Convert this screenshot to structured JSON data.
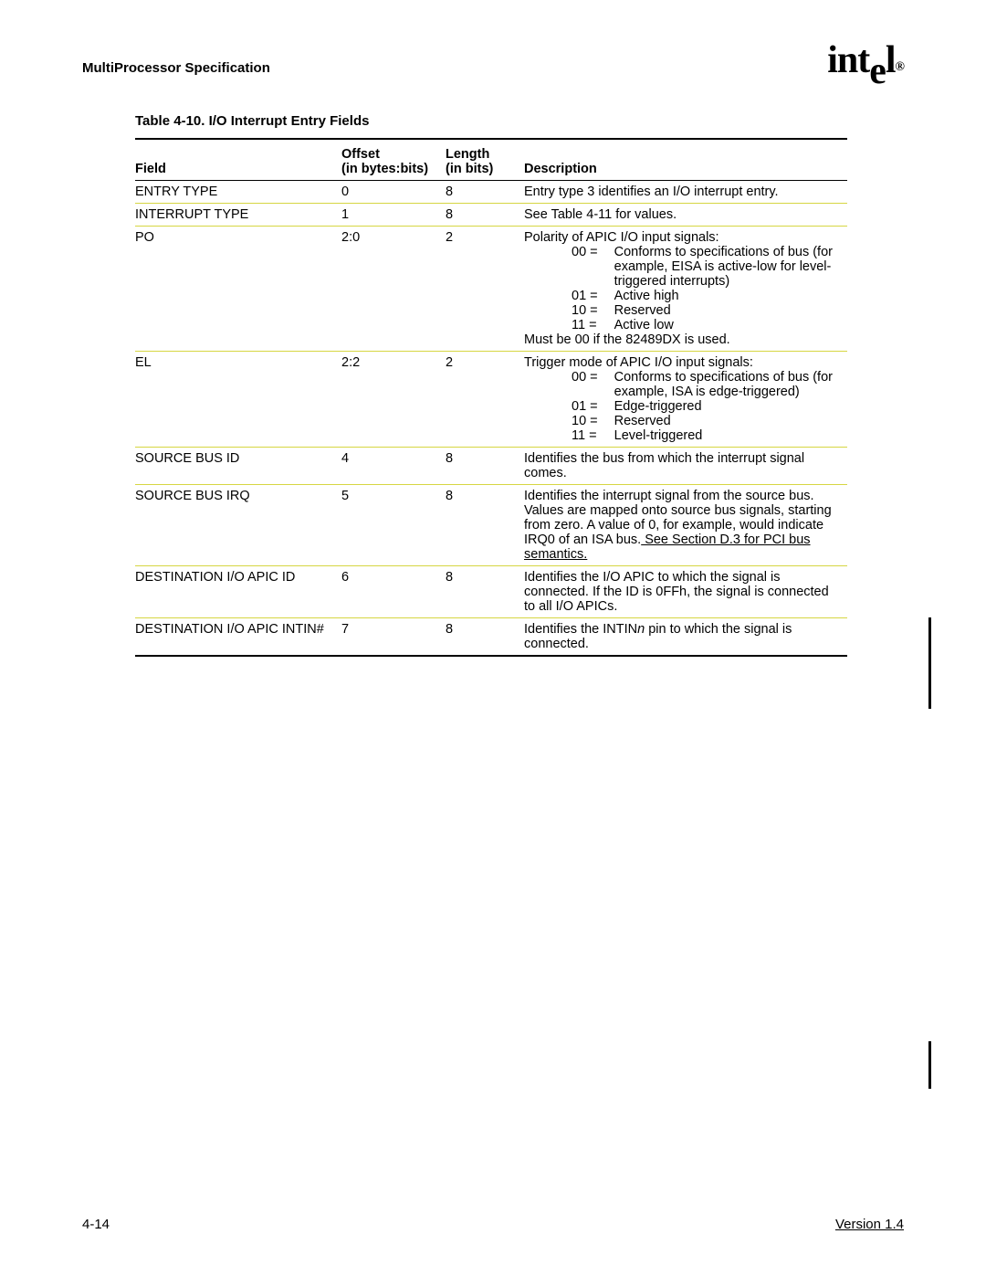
{
  "header": {
    "spec_title": "MultiProcessor Specification",
    "logo_text": "intel"
  },
  "caption": "Table 4-10.  I/O Interrupt Entry Fields",
  "columns": {
    "field": "Field",
    "offset_l1": "Offset",
    "offset_l2": "(in bytes:bits)",
    "length_l1": "Length",
    "length_l2": "(in bits)",
    "desc": "Description"
  },
  "rows": [
    {
      "field": "ENTRY TYPE",
      "offset": "0",
      "length": "8",
      "desc_pre": "Entry type 3 identifies an I/O interrupt entry."
    },
    {
      "field": "INTERRUPT TYPE",
      "offset": "1",
      "length": "8",
      "desc_pre": "See Table 4-11 for values."
    },
    {
      "field": "PO",
      "offset": "2:0",
      "length": "2",
      "desc_pre": "Polarity of APIC I/O input signals:",
      "sub": [
        {
          "k": "00 =",
          "v": "Conforms to specifications of bus (for example, EISA is active-low for level-triggered interrupts)"
        },
        {
          "k": "01 =",
          "v": "Active high"
        },
        {
          "k": "10 =",
          "v": "Reserved"
        },
        {
          "k": "11 =",
          "v": "Active low"
        }
      ],
      "desc_post": "Must be 00 if the 82489DX is used."
    },
    {
      "field": "EL",
      "offset": "2:2",
      "length": "2",
      "desc_pre": "Trigger mode of APIC I/O input signals:",
      "sub": [
        {
          "k": "00 =",
          "v": "Conforms to specifications of bus (for example, ISA is edge-triggered)"
        },
        {
          "k": "01 =",
          "v": "Edge-triggered"
        },
        {
          "k": "10 =",
          "v": "Reserved"
        },
        {
          "k": "11 =",
          "v": "Level-triggered"
        }
      ]
    },
    {
      "field": "SOURCE BUS ID",
      "offset": "4",
      "length": "8",
      "desc_pre": "Identifies the bus from which the interrupt signal comes."
    },
    {
      "field": "SOURCE BUS IRQ",
      "offset": "5",
      "length": "8",
      "desc_pre": "Identifies the interrupt signal from the source bus.  Values are mapped onto source bus signals, starting from zero.  A value of 0, for example, would indicate IRQ0 of an ISA bus.",
      "link_text": "  See Section D.3 for PCI bus semantics."
    },
    {
      "field": "DESTINATION I/O APIC ID",
      "offset": "6",
      "length": "8",
      "desc_pre": "Identifies the I/O APIC to which the signal is connected.  If the ID is 0FFh, the signal is connected to all I/O APICs."
    },
    {
      "field": "DESTINATION I/O APIC INTIN#",
      "offset": "7",
      "length": "8",
      "desc_pre": "Identifies the INTIN",
      "italic_part": "n",
      "desc_post_inline": " pin to which the signal is connected."
    }
  ],
  "footer": {
    "page": "4-14",
    "version": "Version 1.4"
  }
}
